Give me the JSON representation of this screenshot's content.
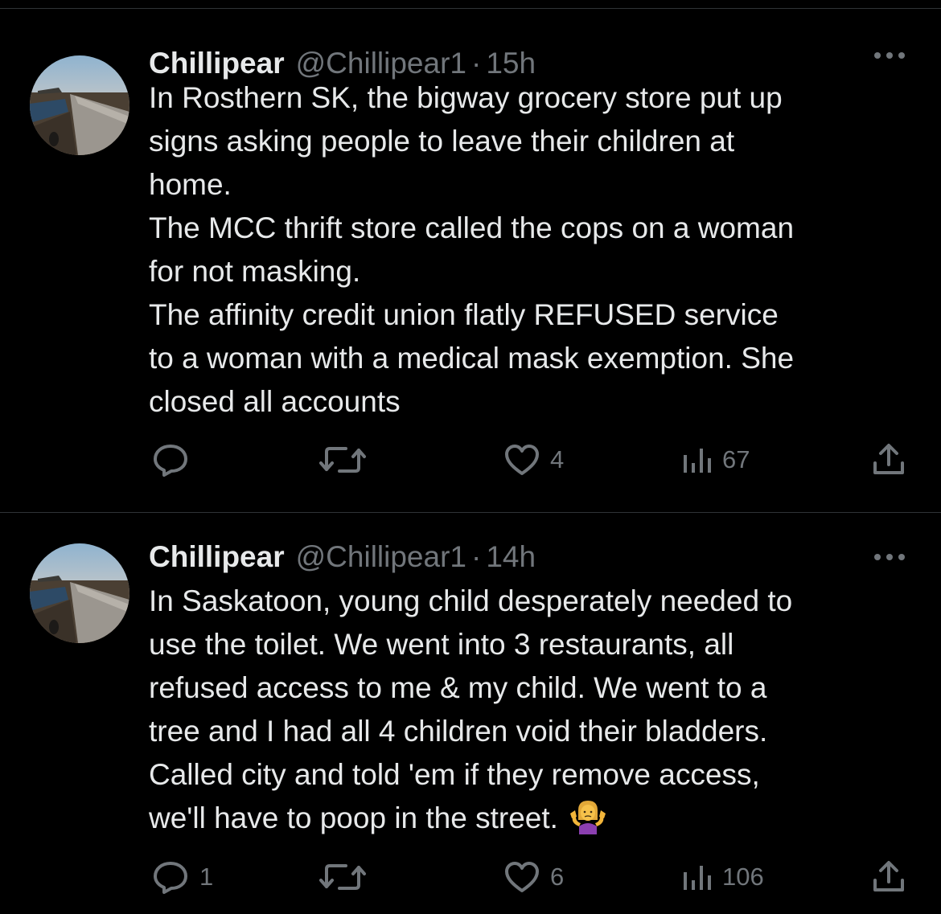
{
  "colors": {
    "background": "#000000",
    "text_primary": "#e7e9ea",
    "text_secondary": "#71767b",
    "divider": "#2f3336"
  },
  "tweets": [
    {
      "display_name": "Chillipear",
      "handle": "@Chillipear1",
      "separator": "·",
      "time": "15h",
      "avatar_icon": "avatar-road-landscape",
      "lines": [
        "In Rosthern SK, the bigway grocery store put up",
        "signs asking people to leave their children at",
        "home.",
        "The MCC thrift store called the cops on a woman",
        "for not masking.",
        "The affinity credit union flatly REFUSED service",
        "to a woman with a medical mask exemption. She",
        "closed all accounts"
      ],
      "actions": {
        "reply_count": "",
        "retweet_count": "",
        "like_count": "4",
        "views_count": "67"
      }
    },
    {
      "display_name": "Chillipear",
      "handle": "@Chillipear1",
      "separator": "·",
      "time": "14h",
      "avatar_icon": "avatar-road-landscape",
      "lines": [
        "In Saskatoon, young child desperately needed to",
        "use the toilet. We went into 3 restaurants, all",
        "refused access to me & my child. We went to a",
        "tree and I had all 4 children void their bladders.",
        "Called city and told 'em if they remove access,",
        "we'll have to poop in the street."
      ],
      "emoji": "person-shrugging-emoji",
      "actions": {
        "reply_count": "1",
        "retweet_count": "",
        "like_count": "6",
        "views_count": "106"
      }
    }
  ]
}
